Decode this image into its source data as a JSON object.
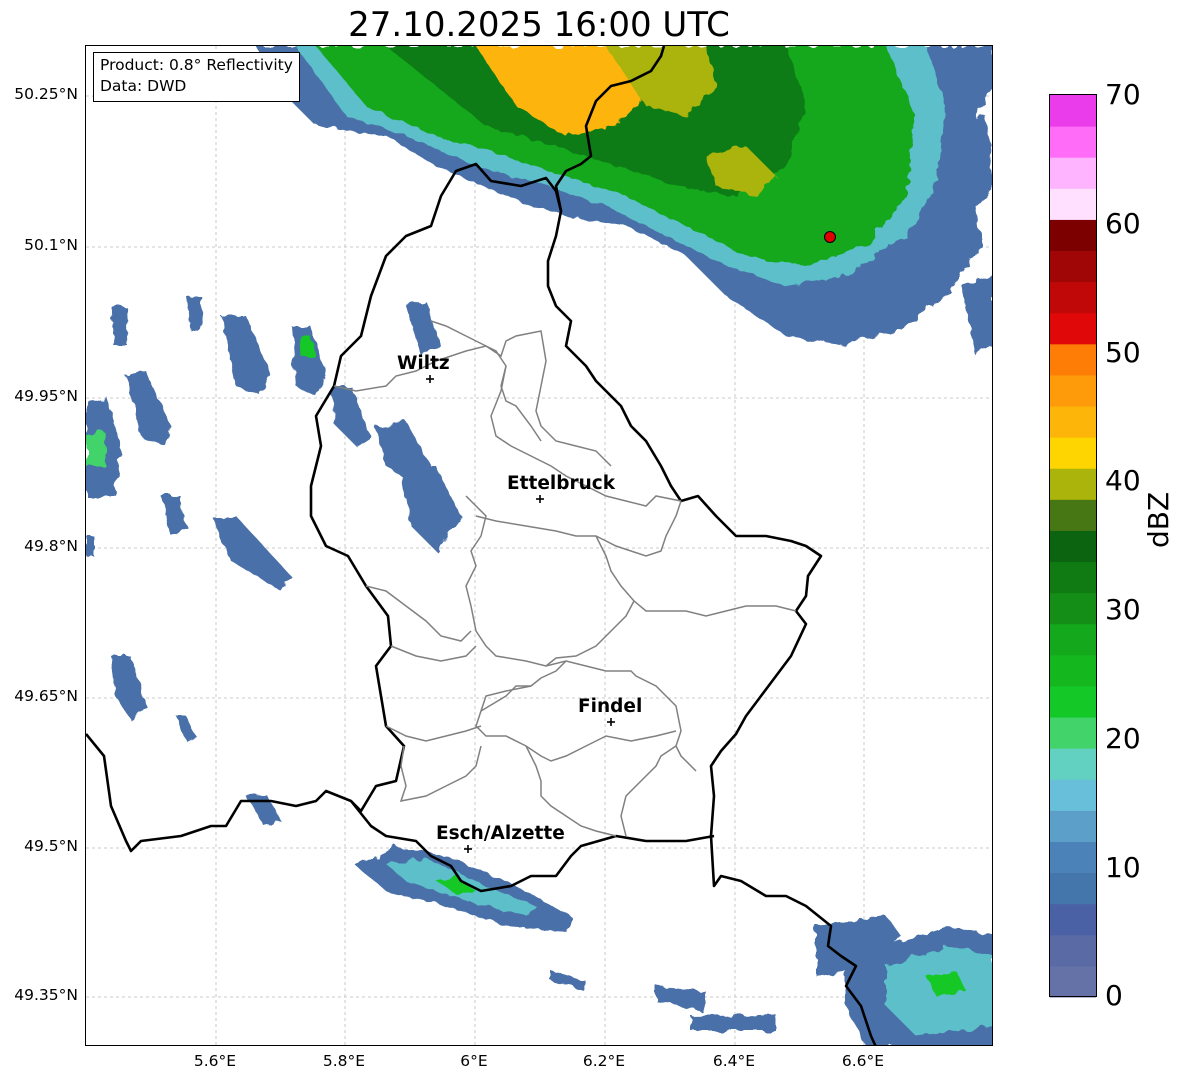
{
  "title": "27.10.2025 16:00 UTC",
  "info_box": {
    "product": "Product: 0.8° Reflectivity",
    "source": "Data: DWD"
  },
  "axes": {
    "lat_ticks": [
      "50.25°N",
      "50.1°N",
      "49.95°N",
      "49.8°N",
      "49.65°N",
      "49.5°N",
      "49.35°N"
    ],
    "lon_ticks": [
      "5.6°E",
      "5.8°E",
      "6°E",
      "6.2°E",
      "6.4°E",
      "6.6°E"
    ],
    "gridlines": true
  },
  "cities": [
    {
      "name": "Wiltz"
    },
    {
      "name": "Ettelbruck"
    },
    {
      "name": "Findel"
    },
    {
      "name": "Esch/Alzette"
    }
  ],
  "radar_site_marker": {
    "color": "#e00000"
  },
  "colorbar": {
    "label": "dBZ",
    "ticks": [
      "70",
      "60",
      "50",
      "40",
      "30",
      "20",
      "10",
      "0"
    ],
    "colors": [
      "#6472a8",
      "#5a6aa5",
      "#4a62a5",
      "#4475ab",
      "#4b82b7",
      "#5c9fc8",
      "#68bfd9",
      "#62d1c2",
      "#42d46b",
      "#14c828",
      "#14b81e",
      "#14a81c",
      "#148e16",
      "#0f7b12",
      "#0c6410",
      "#477614",
      "#aab40a",
      "#fed500",
      "#fdb50a",
      "#fd9b0a",
      "#fd7d06",
      "#e00808",
      "#c00808",
      "#a00606",
      "#7c0000",
      "#ffe1ff",
      "#ffb4ff",
      "#ff6cf8",
      "#ea3ceb"
    ]
  },
  "colors": {
    "country_border": "#000000",
    "canton_border": "#808080",
    "grid": "#bbbbbb"
  }
}
